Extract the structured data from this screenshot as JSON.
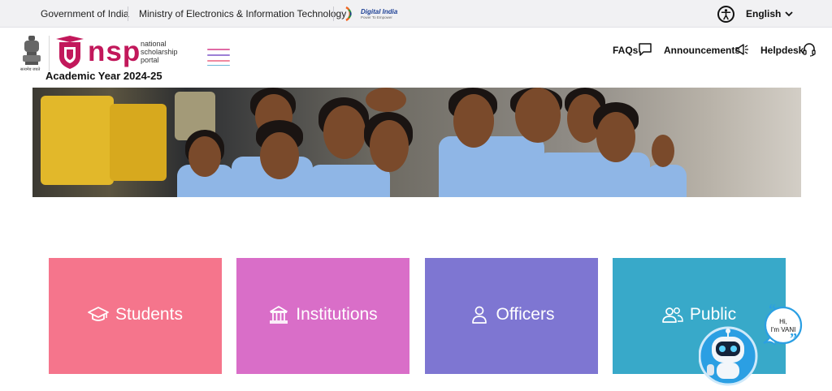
{
  "topbar": {
    "gov_label": "Government of India",
    "ministry_label": "Ministry of Electronics & Information Technology",
    "digital_india": "Digital India",
    "digital_india_tagline": "Power To Empower",
    "language": "English"
  },
  "header": {
    "emblem_caption": "सत्यमेव जयते",
    "logo_word": "NSP",
    "logo_tag_1": "national",
    "logo_tag_2": "scholarship",
    "logo_tag_3": "portal",
    "academic_year": "Academic Year 2024-25",
    "nav": [
      {
        "label": "FAQs",
        "icon": "chat-icon"
      },
      {
        "label": "Announcements",
        "icon": "megaphone-icon"
      },
      {
        "label": "Helpdesk",
        "icon": "headset-icon"
      }
    ]
  },
  "cards": [
    {
      "label": "Students",
      "icon": "graduation-cap-icon",
      "color": "#f5758c"
    },
    {
      "label": "Institutions",
      "icon": "institution-icon",
      "color": "#d96ec8"
    },
    {
      "label": "Officers",
      "icon": "user-icon",
      "color": "#7e76d2"
    },
    {
      "label": "Public",
      "icon": "users-icon",
      "color": "#38a9c9"
    }
  ],
  "chatbot": {
    "line1": "Hi,",
    "line2": "I'm VANI"
  },
  "colors": {
    "brand": "#c2185b",
    "topbar_bg": "#f1f1f3"
  }
}
